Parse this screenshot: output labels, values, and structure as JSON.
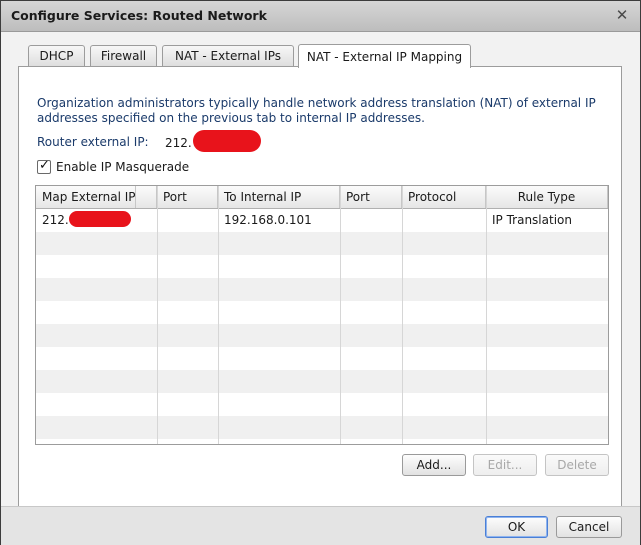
{
  "window": {
    "title": "Configure Services: Routed Network",
    "close_glyph": "✕"
  },
  "tabs": [
    {
      "label": "DHCP",
      "active": false
    },
    {
      "label": "Firewall",
      "active": false
    },
    {
      "label": "NAT - External IPs",
      "active": false
    },
    {
      "label": "NAT - External IP Mapping",
      "active": true
    }
  ],
  "panel": {
    "description": "Organization administrators typically handle network address translation (NAT) of external IP addresses specified on the previous tab to internal IP addresses.",
    "router_label": "Router external IP:",
    "router_value_prefix": "212.",
    "masquerade_label": "Enable IP Masquerade",
    "masquerade_checked": true
  },
  "table": {
    "columns": [
      "Map External IP",
      "Port",
      "To Internal IP",
      "Port",
      "Protocol",
      "Rule Type"
    ],
    "rows": [
      {
        "external_ip_prefix": "212.",
        "external_port": "",
        "internal_ip": "192.168.0.101",
        "internal_port": "",
        "protocol": "",
        "rule_type": "IP Translation"
      }
    ]
  },
  "actions": {
    "add": "Add...",
    "edit": "Edit...",
    "delete": "Delete"
  },
  "footer": {
    "ok": "OK",
    "cancel": "Cancel"
  },
  "colors": {
    "redaction": "#e8131b",
    "default_button_border": "#4a7fd6"
  }
}
